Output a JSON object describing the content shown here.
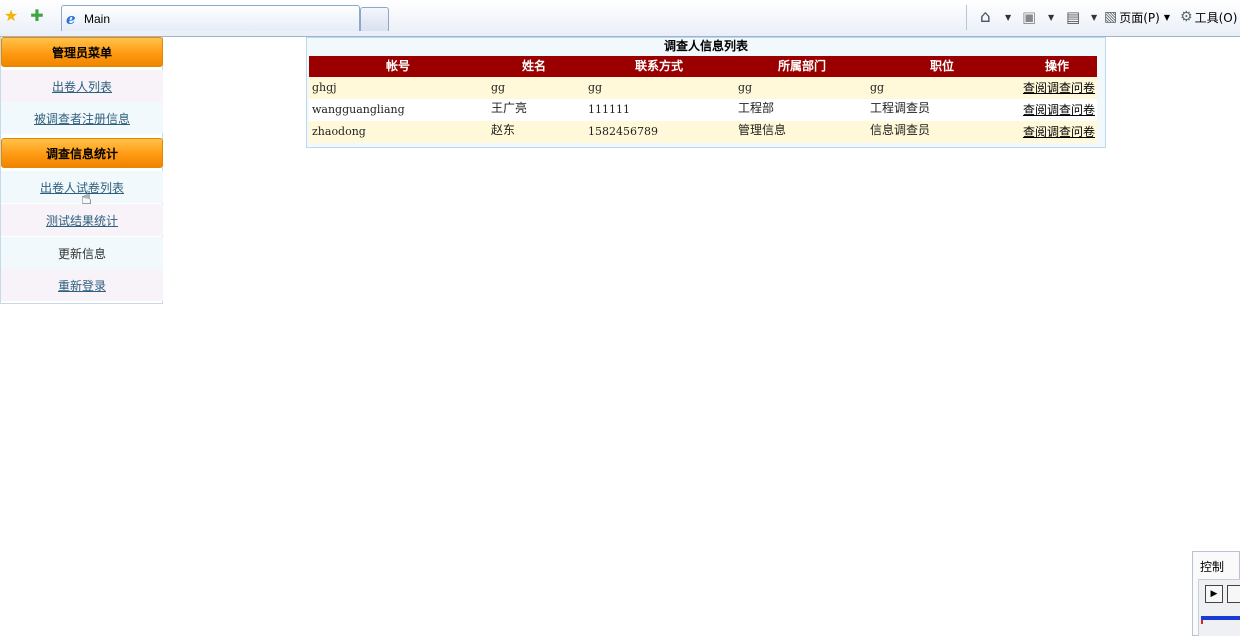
{
  "browser": {
    "tab_title": "Main",
    "page_menu": "页面(P)",
    "tools_menu": "工具(O)",
    "icons": [
      "favorites-star-icon",
      "add-favorite-icon",
      "ie-icon",
      "home-icon",
      "feeds-icon",
      "print-icon",
      "page-icon",
      "gear-icon"
    ]
  },
  "sidebar": {
    "sections": [
      {
        "header": "管理员菜单",
        "items": [
          {
            "label": "出卷人列表"
          },
          {
            "label": "被调查者注册信息"
          }
        ]
      },
      {
        "header": "调查信息统计",
        "items": [
          {
            "label": "出卷人试卷列表"
          },
          {
            "label": "测试结果统计"
          },
          {
            "label": "更新信息"
          },
          {
            "label": "重新登录"
          }
        ]
      }
    ]
  },
  "table": {
    "title": "调查人信息列表",
    "columns": [
      "帐号",
      "姓名",
      "联系方式",
      "所属部门",
      "职位",
      "操作"
    ],
    "rows": [
      {
        "account": "ghgj",
        "name": "gg",
        "contact": "gg",
        "department": "gg",
        "position": "gg",
        "action": "查阅调查问卷"
      },
      {
        "account": "wangguangliang",
        "name": "王广亮",
        "contact": "111111",
        "department": "工程部",
        "position": "工程调查员",
        "action": "查阅调查问卷"
      },
      {
        "account": "zhaodong",
        "name": "赵东",
        "contact": "1582456789",
        "department": "管理信息",
        "position": "信息调查员",
        "action": "查阅调查问卷"
      }
    ]
  },
  "control": {
    "title": "控制"
  },
  "colors": {
    "header_bg": "#9b0000",
    "menu_header": "#ff9a12",
    "row_odd": "#fff9d9"
  }
}
